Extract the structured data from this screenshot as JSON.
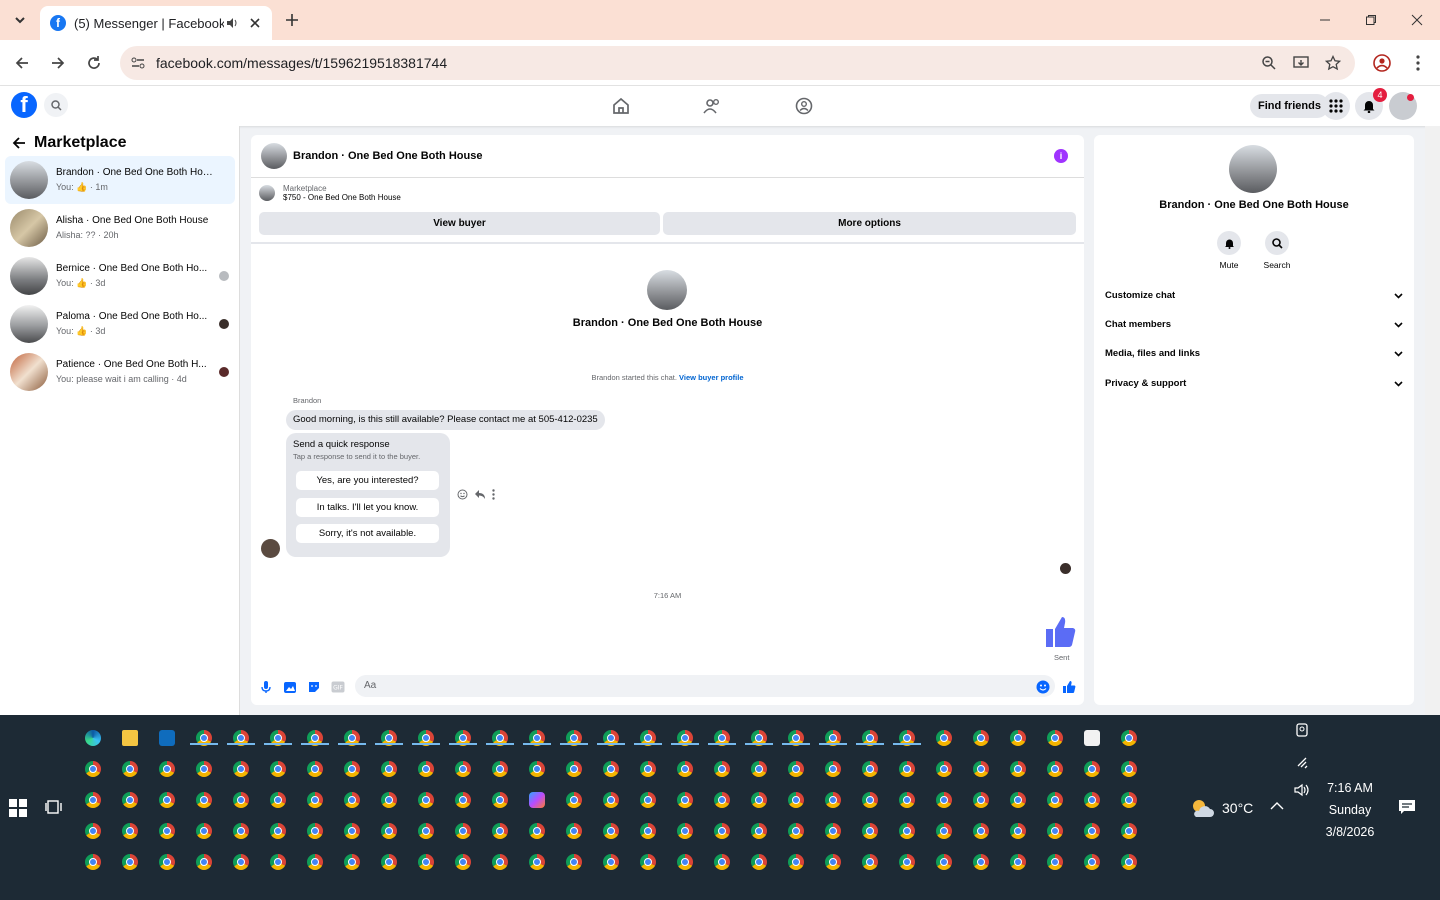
{
  "browser": {
    "tab_title": "(5) Messenger | Facebook",
    "url": "facebook.com/messages/t/1596219518381744"
  },
  "fb_header": {
    "find_friends": "Find friends",
    "notification_count": "4"
  },
  "left": {
    "title": "Marketplace",
    "conversations": [
      {
        "name": "Brandon · One Bed One Both House",
        "preview": "You: 👍 · 1m"
      },
      {
        "name": "Alisha · One Bed One Both House",
        "preview": "Alisha: ?? · 20h"
      },
      {
        "name": "Bernice · One Bed One Both Ho...",
        "preview": "You: 👍 · 3d"
      },
      {
        "name": "Paloma · One Bed One Both Ho...",
        "preview": "You: 👍 · 3d"
      },
      {
        "name": "Patience · One Bed One Both H...",
        "preview": "You: please wait i am calling · 4d"
      }
    ]
  },
  "chat": {
    "title": "Brandon · One Bed One Both House",
    "mp_label": "Marketplace",
    "mp_item": "$750 - One Bed One Both House",
    "view_buyer": "View buyer",
    "more_options": "More options",
    "center_name": "Brandon · One Bed One Both House",
    "started_text": "Brandon started this chat.",
    "view_profile": "View buyer profile",
    "sender": "Brandon",
    "message": "Good morning, is this still available? Please contact me at 505-412-0235",
    "quick_title": "Send a quick response",
    "quick_sub": "Tap a response to send it to the buyer.",
    "quick_options": [
      "Yes, are you interested?",
      "In talks. I'll let you know.",
      "Sorry, it's not available."
    ],
    "timestamp": "7:16 AM",
    "sent": "Sent",
    "input_placeholder": "Aa"
  },
  "info": {
    "name": "Brandon · One Bed One Both House",
    "mute": "Mute",
    "search": "Search",
    "sections": [
      "Customize chat",
      "Chat members",
      "Media, files and links",
      "Privacy & support"
    ]
  },
  "taskbar": {
    "temp": "30°C",
    "time": "7:16 AM",
    "day": "Sunday",
    "date": "3/8/2026"
  },
  "colors": {
    "fb_blue": "#0866ff",
    "accent_purple": "#a033ff",
    "thumb": "#5b6cf5"
  }
}
